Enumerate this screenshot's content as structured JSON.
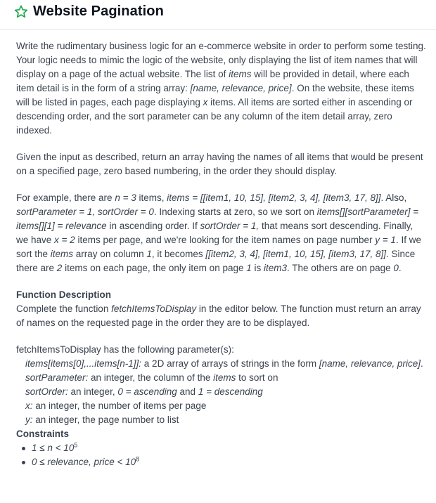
{
  "header": {
    "title": "Website Pagination",
    "star_icon": "star-outline-icon",
    "star_color": "#1ba94c"
  },
  "problem": {
    "p1": [
      {
        "t": "Write the rudimentary business logic for an e-commerce website in order to perform some testing. Your logic needs to mimic the logic of the website, only displaying the list of item names that will display on a page of the actual website. The list of "
      },
      {
        "t": "items",
        "i": true
      },
      {
        "t": " will be provided in detail, where each item detail is in the form of a string array: "
      },
      {
        "t": "[name, relevance, price]",
        "i": true
      },
      {
        "t": ". On the website, these items will be listed in pages, each page displaying "
      },
      {
        "t": "x",
        "i": true
      },
      {
        "t": " items. All items are sorted either in ascending or descending order, and the sort parameter can be any column of the item detail array, zero indexed."
      }
    ],
    "p2": [
      {
        "t": "Given the input as described, return an array having the names of all items that would be present on a specified page, zero based numbering, in the order they should display."
      }
    ],
    "p3": [
      {
        "t": "For example, there are "
      },
      {
        "t": "n = 3",
        "i": true
      },
      {
        "t": " items, "
      },
      {
        "t": "items = [[item1, 10, 15], [item2, 3, 4], [item3, 17, 8]]",
        "i": true
      },
      {
        "t": ". Also, "
      },
      {
        "t": "sortParameter = 1, sortOrder = 0",
        "i": true
      },
      {
        "t": ". Indexing starts at zero, so we sort on "
      },
      {
        "t": "items[][sortParameter] = items[][1] = relevance",
        "i": true
      },
      {
        "t": " in ascending order. If "
      },
      {
        "t": "sortOrder = 1,",
        "i": true
      },
      {
        "t": " that means sort descending. Finally, we have "
      },
      {
        "t": "x = 2",
        "i": true
      },
      {
        "t": " items per page, and we're looking for the item names on page number "
      },
      {
        "t": "y = 1",
        "i": true
      },
      {
        "t": ". If we sort the "
      },
      {
        "t": "items",
        "i": true
      },
      {
        "t": " array on column "
      },
      {
        "t": "1",
        "i": true
      },
      {
        "t": ", it becomes "
      },
      {
        "t": "[[item2, 3, 4], [item1, 10, 15], [item3, 17, 8]]",
        "i": true
      },
      {
        "t": ". Since there are "
      },
      {
        "t": "2",
        "i": true
      },
      {
        "t": " items on each page, the only item on page "
      },
      {
        "t": "1",
        "i": true
      },
      {
        "t": " is "
      },
      {
        "t": "item3",
        "i": true
      },
      {
        "t": ". The others are on page "
      },
      {
        "t": "0",
        "i": true
      },
      {
        "t": "."
      }
    ],
    "function_description_title": "Function Description",
    "p4": [
      {
        "t": "Complete the function "
      },
      {
        "t": "fetchItemsToDisplay",
        "i": true
      },
      {
        "t": " in the editor below. The function must return an array of names on the requested page in the order they are to be displayed."
      }
    ],
    "params_intro": "fetchItemsToDisplay has the following parameter(s):",
    "params": [
      [
        {
          "t": "items[items[0],...items[n-1]]:",
          "i": true
        },
        {
          "t": "  a 2D array of arrays of strings in the form "
        },
        {
          "t": "[name, relevance, price]",
          "i": true
        },
        {
          "t": "."
        }
      ],
      [
        {
          "t": "sortParameter:",
          "i": true
        },
        {
          "t": " an integer, the column of the "
        },
        {
          "t": "items",
          "i": true
        },
        {
          "t": " to sort on"
        }
      ],
      [
        {
          "t": "sortOrder:",
          "i": true
        },
        {
          "t": " an integer, "
        },
        {
          "t": "0 = ascending",
          "i": true
        },
        {
          "t": " and "
        },
        {
          "t": "1 = descending",
          "i": true
        }
      ],
      [
        {
          "t": "x:",
          "i": true
        },
        {
          "t": " an integer, the number of items per page"
        }
      ],
      [
        {
          "t": "y:",
          "i": true
        },
        {
          "t": " an integer, the page number to list"
        }
      ]
    ],
    "constraints_title": "Constraints",
    "constraints": [
      [
        {
          "t": "1 ≤ n < 10",
          "i": true
        },
        {
          "t": "5",
          "sup": true
        }
      ],
      [
        {
          "t": "0 ≤ relevance, price < 10",
          "i": true
        },
        {
          "t": "8",
          "sup": true
        }
      ]
    ]
  }
}
